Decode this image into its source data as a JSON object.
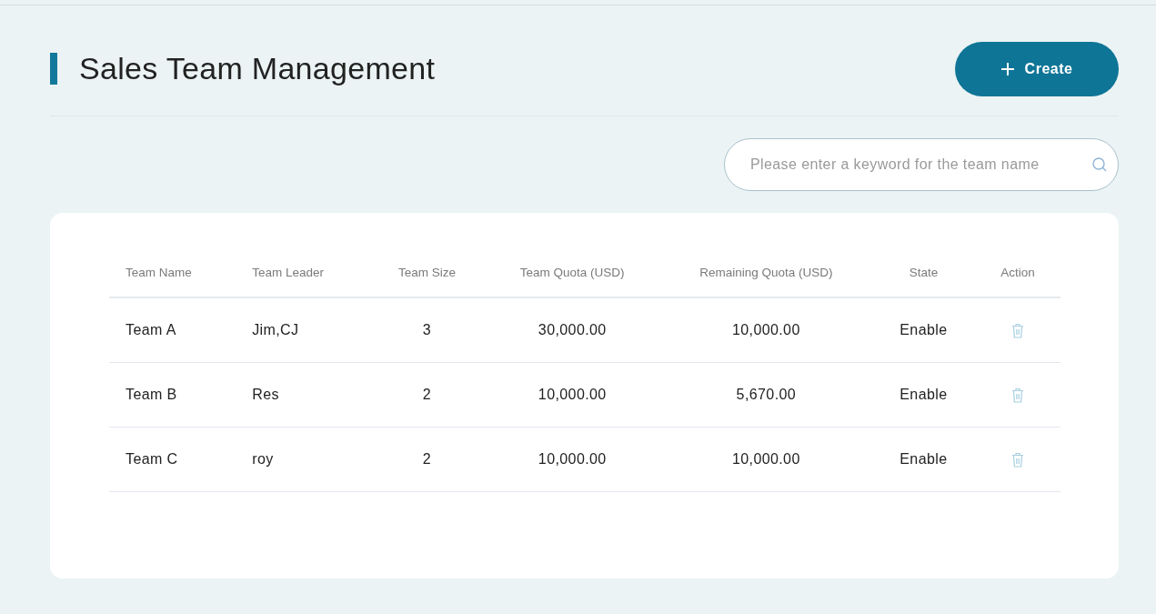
{
  "header": {
    "title": "Sales Team Management",
    "create_button": "Create"
  },
  "search": {
    "placeholder": "Please enter a keyword for the team name"
  },
  "table": {
    "columns": [
      "Team Name",
      "Team Leader",
      "Team Size",
      "Team Quota (USD)",
      "Remaining Quota (USD)",
      "State",
      "Action"
    ],
    "rows": [
      {
        "team_name": "Team A",
        "team_leader": "Jim,CJ",
        "team_size": "3",
        "team_quota": "30,000.00",
        "remaining_quota": "10,000.00",
        "state": "Enable"
      },
      {
        "team_name": "Team B",
        "team_leader": "Res",
        "team_size": "2",
        "team_quota": "10,000.00",
        "remaining_quota": "5,670.00",
        "state": "Enable"
      },
      {
        "team_name": "Team C",
        "team_leader": "roy",
        "team_size": "2",
        "team_quota": "10,000.00",
        "remaining_quota": "10,000.00",
        "state": "Enable"
      }
    ]
  }
}
